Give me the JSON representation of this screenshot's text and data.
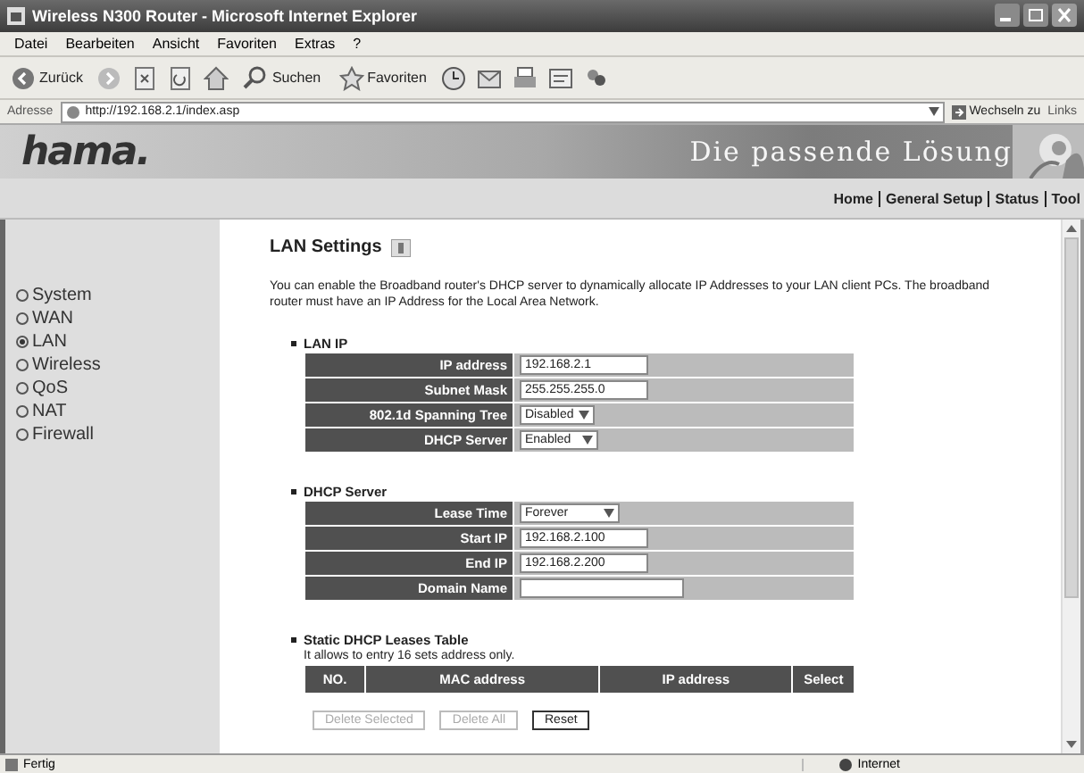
{
  "window": {
    "title": "Wireless N300 Router - Microsoft Internet Explorer"
  },
  "menu": [
    "Datei",
    "Bearbeiten",
    "Ansicht",
    "Favoriten",
    "Extras",
    "?"
  ],
  "toolbar": [
    {
      "kind": "back",
      "label": "Zurück"
    },
    {
      "kind": "forward"
    },
    {
      "kind": "stop"
    },
    {
      "kind": "refresh"
    },
    {
      "kind": "home"
    },
    {
      "kind": "search",
      "label": "Suchen"
    },
    {
      "kind": "favorites",
      "label": "Favoriten"
    },
    {
      "kind": "history"
    },
    {
      "kind": "mail"
    },
    {
      "kind": "print"
    },
    {
      "kind": "edit"
    },
    {
      "kind": "messenger"
    }
  ],
  "address": {
    "label": "Adresse",
    "value": "http://192.168.2.1/index.asp",
    "go": "Wechseln zu",
    "links": "Links"
  },
  "banner": {
    "logo": "hama.",
    "slogan": "Die passende Lösung"
  },
  "nav": [
    "Home",
    "General Setup",
    "Status",
    "Tool"
  ],
  "sidebar": [
    {
      "label": "System",
      "selected": false
    },
    {
      "label": "WAN",
      "selected": false
    },
    {
      "label": "LAN",
      "selected": true
    },
    {
      "label": "Wireless",
      "selected": false
    },
    {
      "label": "QoS",
      "selected": false
    },
    {
      "label": "NAT",
      "selected": false
    },
    {
      "label": "Firewall",
      "selected": false
    }
  ],
  "page": {
    "title": "LAN Settings",
    "intro": "You can enable the Broadband router's DHCP server to dynamically allocate IP Addresses to your LAN client PCs. The broadband router must have an IP Address for the Local Area Network."
  },
  "sections": [
    {
      "heading": "LAN IP",
      "fields": [
        {
          "label": "IP address",
          "kind": "text",
          "value": "192.168.2.1"
        },
        {
          "label": "Subnet Mask",
          "kind": "text",
          "value": "255.255.255.0"
        },
        {
          "label": "802.1d Spanning Tree",
          "kind": "select",
          "value": "Disabled"
        },
        {
          "label": "DHCP Server",
          "kind": "select",
          "value": "Enabled"
        }
      ]
    },
    {
      "heading": "DHCP Server",
      "fields": [
        {
          "label": "Lease Time",
          "kind": "select",
          "value": "Forever"
        },
        {
          "label": "Start IP",
          "kind": "text",
          "value": "192.168.2.100"
        },
        {
          "label": "End IP",
          "kind": "text",
          "value": "192.168.2.200"
        },
        {
          "label": "Domain Name",
          "kind": "wide"
        }
      ]
    }
  ],
  "leases": {
    "heading": "Static DHCP Leases Table",
    "note": "It allows to entry 16 sets address only.",
    "columns": [
      "NO.",
      "MAC address",
      "IP address",
      "Select"
    ]
  },
  "buttons": [
    {
      "label": "Delete Selected",
      "disabled": true
    },
    {
      "label": "Delete All",
      "disabled": true
    },
    {
      "label": "Reset",
      "disabled": false
    }
  ],
  "status_bar": {
    "text": "Fertig",
    "zone": "Internet"
  }
}
